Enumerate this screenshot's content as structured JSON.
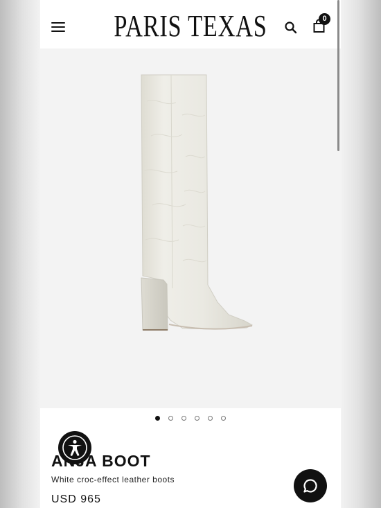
{
  "header": {
    "logo_text": "PARIS TEXAS",
    "menu_icon": "hamburger-menu-icon",
    "search_icon": "search-icon",
    "cart_icon": "shopping-bag-icon",
    "cart_count": "0"
  },
  "gallery": {
    "zoom_icon": "zoom-in-icon",
    "image_subject": "white knee-high croc-effect leather boot with block heel",
    "dot_count": 6,
    "active_index": 0
  },
  "product": {
    "title": "ANJA BOOT",
    "subtitle": "White croc-effect leather boots",
    "price": "USD 965"
  },
  "widgets": {
    "accessibility_icon": "accessibility-icon",
    "chat_icon": "chat-bubble-icon"
  },
  "colors": {
    "accent": "#111111",
    "gallery_bg": "#f3f3f3",
    "boot": "#ecebe3"
  }
}
